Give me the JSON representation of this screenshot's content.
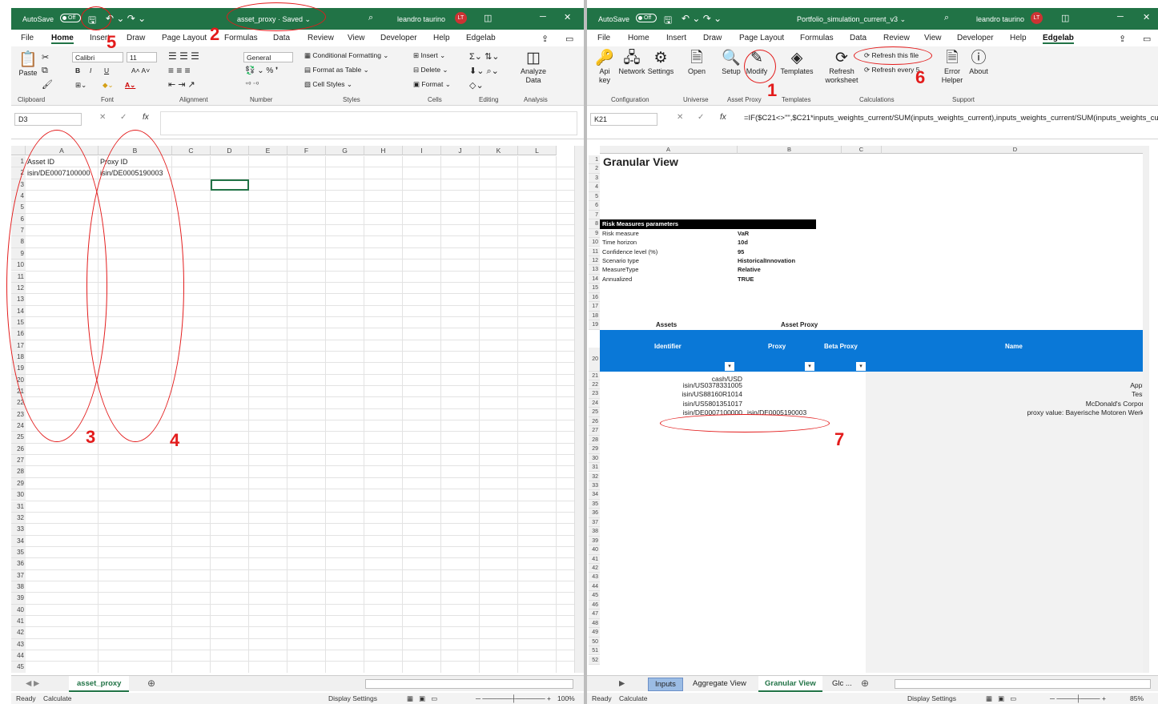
{
  "left": {
    "autosave": "AutoSave",
    "toggle": "Off",
    "title": "asset_proxy · Saved ⌄",
    "user": "leandro taurino",
    "initials": "LT",
    "menu": [
      "File",
      "Home",
      "Insert",
      "Draw",
      "Page Layout",
      "Formulas",
      "Data",
      "Review",
      "View",
      "Developer",
      "Help",
      "Edgelab"
    ],
    "ribbon": {
      "paste": "Paste",
      "font": "Calibri",
      "size": "11",
      "number_format": "General",
      "cond_format": "Conditional Formatting",
      "format_table": "Format as Table",
      "cell_styles": "Cell Styles",
      "insert": "Insert",
      "delete": "Delete",
      "format": "Format",
      "analyze": "Analyze Data",
      "groups": [
        "Clipboard",
        "Font",
        "Alignment",
        "Number",
        "Styles",
        "Cells",
        "Editing",
        "Analysis"
      ]
    },
    "namebox": "D3",
    "columns": [
      "A",
      "B",
      "C",
      "D",
      "E",
      "F",
      "G",
      "H",
      "I",
      "J",
      "K",
      "L"
    ],
    "cells": {
      "a1": "Asset ID",
      "b1": "Proxy ID",
      "a2": "isin/DE0007100000",
      "b2": "isin/DE0005190003"
    },
    "sheet_tab": "asset_proxy",
    "status": {
      "ready": "Ready",
      "calculate": "Calculate",
      "display": "Display Settings",
      "zoom": "100%"
    }
  },
  "right": {
    "autosave": "AutoSave",
    "toggle": "Off",
    "title": "Portfolio_simulation_current_v3 ⌄",
    "user": "leandro taurino",
    "initials": "LT",
    "menu": [
      "File",
      "Home",
      "Insert",
      "Draw",
      "Page Layout",
      "Formulas",
      "Data",
      "Review",
      "View",
      "Developer",
      "Help",
      "Edgelab"
    ],
    "ribbon": {
      "api": "Api key",
      "network": "Network",
      "settings": "Settings",
      "open": "Open",
      "setup": "Setup",
      "modify": "Modify",
      "templates": "Templates",
      "refresh": "Refresh worksheet",
      "refresh_file": "Refresh this file",
      "refresh_every": "Refresh every 5",
      "error": "Error Helper",
      "about": "About",
      "groups": [
        "Configuration",
        "Universe",
        "Asset Proxy",
        "Templates",
        "Calculations",
        "Support"
      ]
    },
    "namebox": "K21",
    "formula": "=IF($C21<>\"\",$C21*inputs_weights_current/SUM(inputs_weights_current),inputs_weights_current/SUM(inputs_weights_current))",
    "columns": [
      "A",
      "B",
      "C",
      "D"
    ],
    "heading": "Granular View",
    "risk_header": "Risk Measures parameters",
    "params": [
      [
        "Risk measure",
        "VaR"
      ],
      [
        "Time horizon",
        "10d"
      ],
      [
        "Confidence level (%)",
        "95"
      ],
      [
        "Scenario type",
        "HistoricalInnovation"
      ],
      [
        "MeasureType",
        "Relative"
      ],
      [
        "Annualized",
        "TRUE"
      ]
    ],
    "section": {
      "assets": "Assets",
      "asset_proxy": "Asset Proxy"
    },
    "table_headers": {
      "identifier": "Identifier",
      "proxy": "Proxy",
      "beta": "Beta Proxy",
      "name": "Name"
    },
    "rows": [
      [
        "cash/USD",
        "",
        "U"
      ],
      [
        "isin/US0378331005",
        "",
        "Apple"
      ],
      [
        "isin/US88160R1014",
        "",
        "Tesla"
      ],
      [
        "isin/US5801351017",
        "",
        "McDonald's Corpora"
      ],
      [
        "isin/DE0007100000",
        "isin/DE0005190003",
        "proxy value: Bayerische Motoren Werke"
      ]
    ],
    "sheet_tabs": [
      "Inputs",
      "Aggregate View",
      "Granular View",
      "Glc ..."
    ],
    "status": {
      "ready": "Ready",
      "calculate": "Calculate",
      "display": "Display Settings",
      "zoom": "85%"
    }
  },
  "annotations": [
    "1",
    "2",
    "3",
    "4",
    "5",
    "6",
    "7"
  ]
}
